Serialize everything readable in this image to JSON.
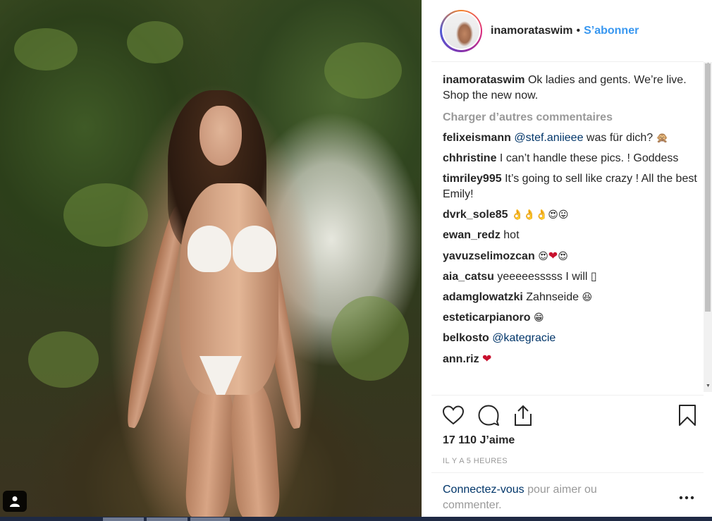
{
  "header": {
    "username": "inamorataswim",
    "separator": "•",
    "follow_label": "S’abonner"
  },
  "caption": {
    "username": "inamorataswim",
    "text": "Ok ladies and gents. We’re live. Shop the new now."
  },
  "load_more_label": "Charger d’autres commentaires",
  "comments": [
    {
      "username": "felixeismann",
      "mention": "@stef.aniieee",
      "text": "was für dich?",
      "emoji": "🙊"
    },
    {
      "username": "chhristine",
      "text": "I can’t handle these pics. ! Goddess"
    },
    {
      "username": "timriley995",
      "text": "It’s going to sell like crazy ! All the best Emily!"
    },
    {
      "username": "dvrk_sole85",
      "emoji": "👌👌👌😍😛"
    },
    {
      "username": "ewan_redz",
      "text": "hot"
    },
    {
      "username": "yavuzselimozcan",
      "emoji": "😍",
      "heart": "❤",
      "emoji2": "😍"
    },
    {
      "username": "aia_catsu",
      "text": "yeeeeesssss I will ▯"
    },
    {
      "username": "adamglowatzki",
      "text": "Zahnseide",
      "emoji": "😆"
    },
    {
      "username": "esteticarpianoro",
      "emoji": "😁"
    },
    {
      "username": "belkosto",
      "mention": "@kategracie"
    },
    {
      "username": "ann.riz",
      "heart": "❤"
    }
  ],
  "likes_label": "17 110 J’aime",
  "timestamp": "IL Y A 5 HEURES",
  "login": {
    "link": "Connectez-vous",
    "text": " pour aimer ou commenter."
  },
  "icons": {
    "like": "heart-outline-icon",
    "comment": "speech-bubble-icon",
    "share": "share-upload-icon",
    "save": "bookmark-icon",
    "more": "ellipsis-icon",
    "user_tag": "person-icon"
  },
  "colors": {
    "link_blue": "#3897f0",
    "mention_navy": "#003569",
    "muted": "#999999",
    "text": "#262626"
  }
}
